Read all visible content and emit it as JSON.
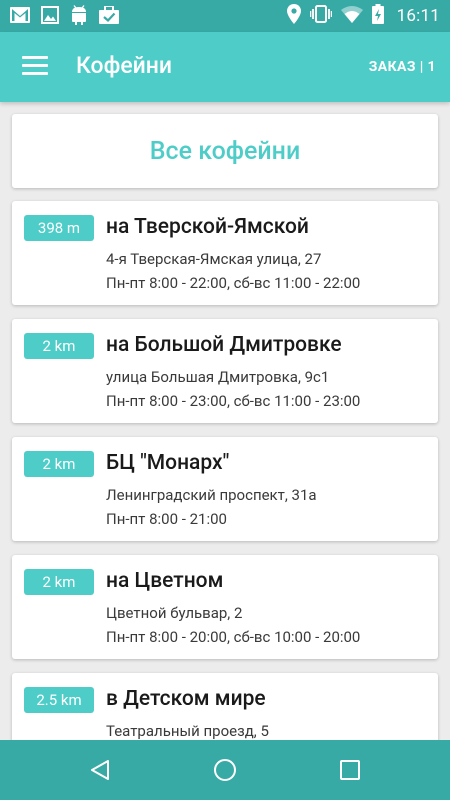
{
  "status_bar": {
    "time": "16:11",
    "left_icons": [
      "gmail-icon",
      "image-icon",
      "android-icon",
      "briefcase-check-icon"
    ],
    "right_icons": [
      "location-icon",
      "vibrate-icon",
      "wifi-icon",
      "battery-icon"
    ]
  },
  "app_bar": {
    "title": "Кофейни",
    "order_label": "ЗАКАЗ | 1"
  },
  "all_shops_label": "Все кофейни",
  "shops": [
    {
      "distance": "398 m",
      "name": "на Тверской-Ямской",
      "address": "4-я Тверская-Ямская улица, 27",
      "hours": "Пн-пт 8:00 - 22:00, сб-вс 11:00 - 22:00"
    },
    {
      "distance": "2 km",
      "name": "на Большой Дмитровке",
      "address": "улица Большая Дмитровка, 9с1",
      "hours": "Пн-пт 8:00 - 23:00, сб-вс 11:00 - 23:00"
    },
    {
      "distance": "2 km",
      "name": "БЦ \"Монарх\"",
      "address": "Ленинградский проспект, 31а",
      "hours": "Пн-пт 8:00 - 21:00"
    },
    {
      "distance": "2 km",
      "name": "на Цветном",
      "address": "Цветной бульвар, 2",
      "hours": "Пн-пт 8:00 - 20:00, сб-вс 10:00 - 20:00"
    },
    {
      "distance": "2.5 km",
      "name": "в Детском мире",
      "address": "Театральный проезд, 5",
      "hours": ""
    }
  ],
  "colors": {
    "accent": "#4ecdc8",
    "status_bar": "#38aaa6",
    "background": "#ececec"
  },
  "nav_bar": {
    "icons": [
      "back-icon",
      "home-icon",
      "recents-icon"
    ]
  }
}
